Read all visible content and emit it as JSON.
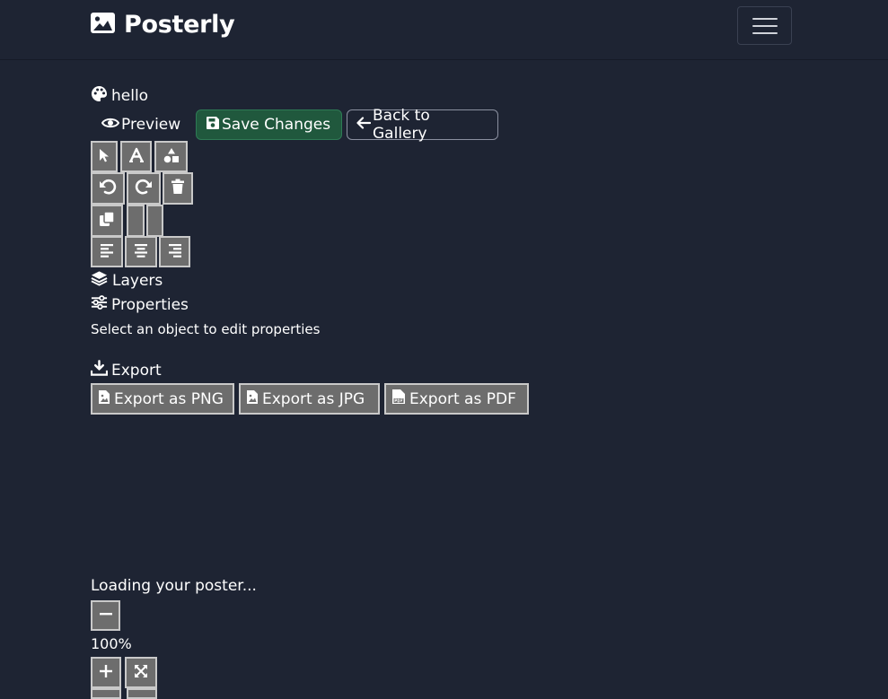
{
  "navbar": {
    "brand": "Posterly",
    "brand_icon": "image-icon",
    "menu_icon": "hamburger-icon"
  },
  "editor": {
    "title": "hello",
    "preview_label": "Preview",
    "save_label": "Save Changes",
    "back_label": "Back to Gallery"
  },
  "tools": {
    "row1": [
      "pointer-icon",
      "text-icon",
      "shapes-icon"
    ],
    "row2": [
      "undo-icon",
      "redo-icon",
      "trash-icon"
    ],
    "row3": [
      "duplicate-icon",
      "bring-forward",
      "send-backward"
    ],
    "row4": [
      "align-left-icon",
      "align-center-icon",
      "align-right-icon"
    ]
  },
  "panels": {
    "layers_label": "Layers",
    "properties_label": "Properties",
    "properties_hint": "Select an object to edit properties",
    "export_label": "Export"
  },
  "export": {
    "png_label": "Export as PNG",
    "jpg_label": "Export as JPG",
    "pdf_label": "Export as PDF"
  },
  "canvas": {
    "loading_text": "Loading your poster...",
    "zoom_level": "100%"
  },
  "colors": {
    "background": "#1e2433",
    "success": "#20583d",
    "tool_button": "#6d6d6d"
  }
}
